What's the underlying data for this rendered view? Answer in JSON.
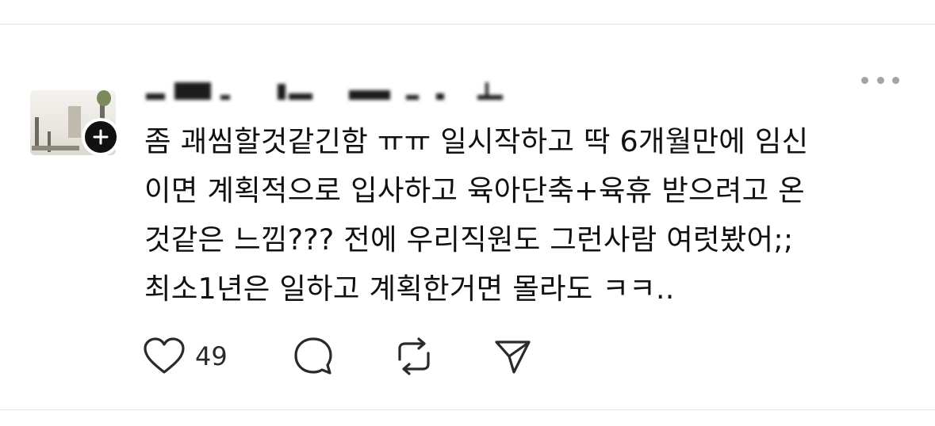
{
  "post": {
    "text_lines": [
      "좀 괘씸할것같긴함 ㅠㅠ 일시작하고 딱 6개월만에 임신",
      "이면 계획적으로 입사하고 육아단축+육휴 받으려고 온",
      "것같은 느낌??? 전에 우리직원도 그런사람 여럿봤어;;",
      "최소1년은 일하고 계획한거면 몰라도 ㅋㅋ.."
    ]
  },
  "actions": {
    "like_count": "49",
    "icons": [
      "heart-icon",
      "comment-icon",
      "repost-icon",
      "share-icon"
    ]
  },
  "header": {
    "more_icon": "more-horizontal-icon",
    "follow_icon": "plus-icon"
  },
  "colors": {
    "text": "#111111",
    "icon": "#2a2a2a",
    "divider": "#e6e6e6",
    "more_dots": "#a3a3a3"
  }
}
